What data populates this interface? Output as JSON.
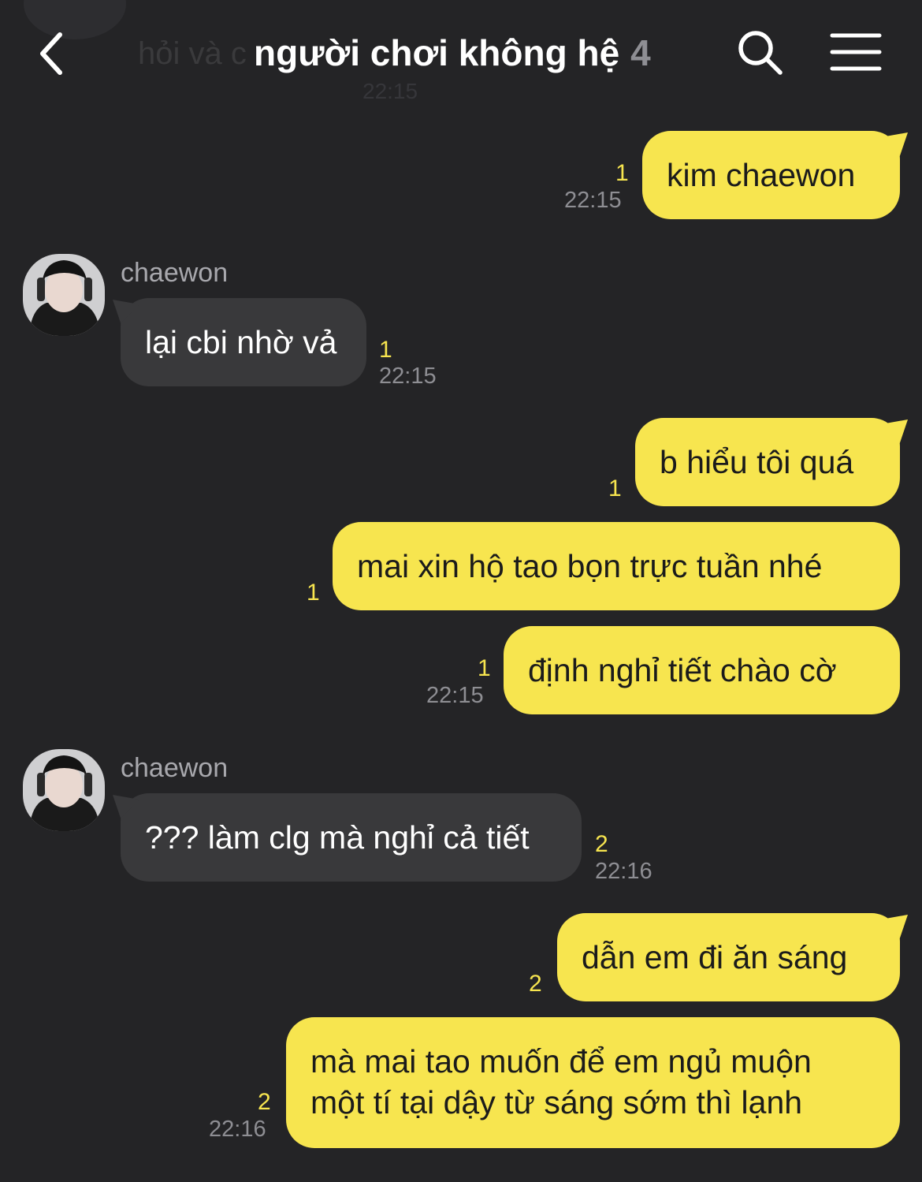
{
  "header": {
    "title": "người chơi không hệ",
    "member_count": "4",
    "ghost_preview": "hỏi và c",
    "ghost_time": "22:15"
  },
  "colors": {
    "background": "#242426",
    "outgoing_bubble": "#f7e54f",
    "incoming_bubble": "#39393b",
    "unread_count": "#f7e54f",
    "timestamp": "#8e8e93"
  },
  "messages": [
    {
      "direction": "out",
      "text": "kim chaewon",
      "unread": "1",
      "time": "22:15"
    },
    {
      "direction": "in",
      "sender": "chaewon",
      "text": "lại cbi nhờ vả",
      "unread": "1",
      "time": "22:15"
    },
    {
      "direction": "out",
      "text": "b hiểu tôi quá",
      "unread": "1"
    },
    {
      "direction": "out",
      "text": "mai xin hộ tao bọn trực tuần nhé",
      "unread": "1"
    },
    {
      "direction": "out",
      "text": "định nghỉ tiết chào cờ",
      "unread": "1",
      "time": "22:15"
    },
    {
      "direction": "in",
      "sender": "chaewon",
      "text": "??? làm clg mà nghỉ cả tiết",
      "unread": "2",
      "time": "22:16"
    },
    {
      "direction": "out",
      "text": "dẫn em đi ăn sáng",
      "unread": "2"
    },
    {
      "direction": "out",
      "lines": [
        "mà mai tao muốn để em ngủ muộn",
        "một tí tại dậy từ sáng sớm thì lạnh"
      ],
      "unread": "2",
      "time": "22:16"
    }
  ],
  "icons": {
    "back": "chevron-left-icon",
    "search": "search-icon",
    "menu": "hamburger-menu-icon"
  }
}
